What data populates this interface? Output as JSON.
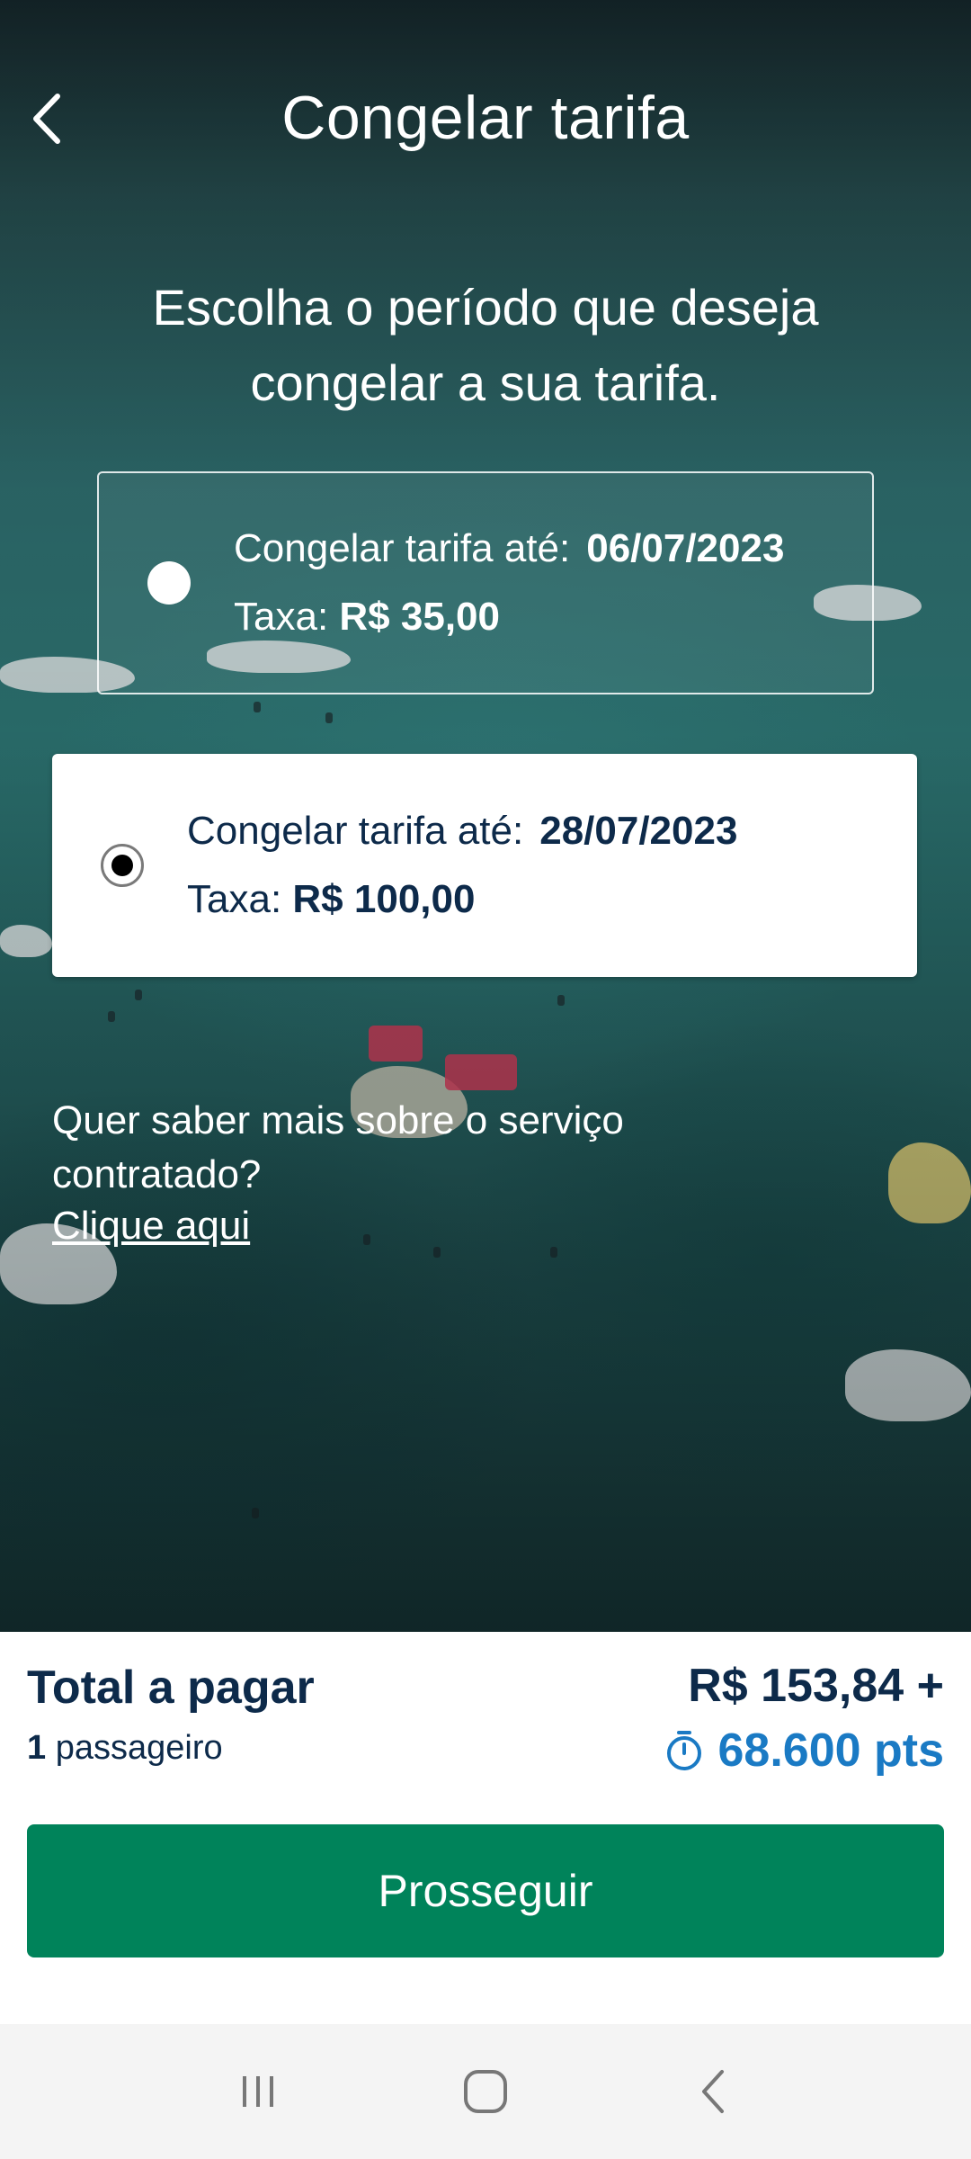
{
  "header": {
    "back_icon": "chevron-left-icon",
    "title": "Congelar tarifa"
  },
  "subtitle": {
    "line1": "Escolha o período que deseja",
    "line2": "congelar a sua tarifa."
  },
  "options": [
    {
      "label": "Congelar tarifa até:",
      "date": "06/07/2023",
      "fee_label": "Taxa:",
      "fee_value": "R$ 35,00",
      "selected": false
    },
    {
      "label": "Congelar tarifa até:",
      "date": "28/07/2023",
      "fee_label": "Taxa:",
      "fee_value": "R$ 100,00",
      "selected": true
    }
  ],
  "info": {
    "text": "Quer saber mais sobre o serviço contratado?",
    "link": "Clique aqui"
  },
  "summary": {
    "total_label": "Total a pagar",
    "passenger_count": "1",
    "passenger_label": "passageiro",
    "price": "R$ 153,84 +",
    "points_icon": "timer-icon",
    "points": "68.600 pts",
    "points_color": "#1a7ac4"
  },
  "actions": {
    "continue_label": "Prosseguir",
    "continue_color": "#00835a"
  },
  "navbar": {
    "recent_icon": "recent-apps-icon",
    "home_icon": "home-icon",
    "back_icon": "back-icon"
  }
}
